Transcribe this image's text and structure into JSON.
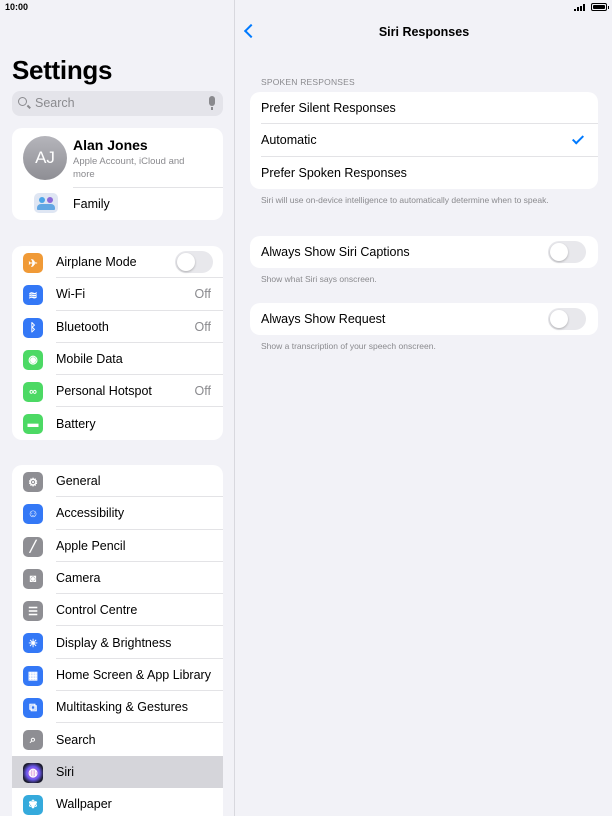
{
  "status": {
    "time": "10:00"
  },
  "sidebar": {
    "title": "Settings",
    "search_placeholder": "Search",
    "profile": {
      "initials": "AJ",
      "name": "Alan Jones",
      "subtitle": "Apple Account, iCloud and more",
      "family": "Family"
    },
    "group1": [
      {
        "label": "Airplane Mode",
        "icon": "airplane-icon",
        "color": "#f09a37",
        "toggle": true
      },
      {
        "label": "Wi-Fi",
        "icon": "wifi-icon",
        "color": "#3478f6",
        "value": "Off"
      },
      {
        "label": "Bluetooth",
        "icon": "bluetooth-icon",
        "color": "#3478f6",
        "value": "Off"
      },
      {
        "label": "Mobile Data",
        "icon": "antenna-icon",
        "color": "#4cd964"
      },
      {
        "label": "Personal Hotspot",
        "icon": "hotspot-icon",
        "color": "#4cd964",
        "value": "Off"
      },
      {
        "label": "Battery",
        "icon": "battery-icon",
        "color": "#4cd964"
      }
    ],
    "group2": [
      {
        "label": "General",
        "icon": "gear-icon",
        "color": "#8e8e93"
      },
      {
        "label": "Accessibility",
        "icon": "accessibility-icon",
        "color": "#3478f6"
      },
      {
        "label": "Apple Pencil",
        "icon": "pencil-icon",
        "color": "#8e8e93"
      },
      {
        "label": "Camera",
        "icon": "camera-icon",
        "color": "#8e8e93"
      },
      {
        "label": "Control Centre",
        "icon": "switches-icon",
        "color": "#8e8e93"
      },
      {
        "label": "Display & Brightness",
        "icon": "sun-icon",
        "color": "#3478f6"
      },
      {
        "label": "Home Screen & App Library",
        "icon": "home-screen-icon",
        "color": "#3478f6"
      },
      {
        "label": "Multitasking & Gestures",
        "icon": "multitasking-icon",
        "color": "#3478f6"
      },
      {
        "label": "Search",
        "icon": "search-icon",
        "color": "#8e8e93"
      },
      {
        "label": "Siri",
        "icon": "siri-icon",
        "color": "#1c1c2e",
        "selected": true
      },
      {
        "label": "Wallpaper",
        "icon": "flower-icon",
        "color": "#35aadc"
      }
    ]
  },
  "main": {
    "title": "Siri Responses",
    "section_header": "SPOKEN RESPONSES",
    "responses": [
      {
        "label": "Prefer Silent Responses",
        "checked": false
      },
      {
        "label": "Automatic",
        "checked": true
      },
      {
        "label": "Prefer Spoken Responses",
        "checked": false
      }
    ],
    "responses_footer": "Siri will use on-device intelligence to automatically determine when to speak.",
    "captions_label": "Always Show Siri Captions",
    "captions_footer": "Show what Siri says onscreen.",
    "request_label": "Always Show Request",
    "request_footer": "Show a transcription of your speech onscreen."
  },
  "colors": {
    "accent": "#007aff",
    "background": "#f2f2f7",
    "selected": "#d5d5da"
  }
}
